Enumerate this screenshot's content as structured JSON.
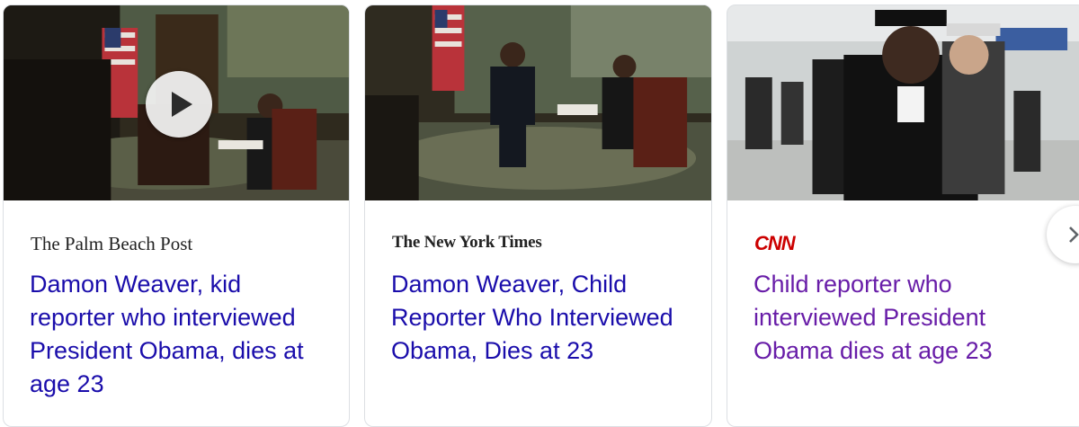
{
  "cards": [
    {
      "source": "The Palm Beach Post",
      "headline": "Damon Weaver, kid reporter who interviewed President Obama, dies at age 23",
      "has_video": true
    },
    {
      "source": "The New York Times",
      "headline": "Damon Weaver, Child Reporter Who Interviewed Obama, Dies at 23",
      "has_video": false
    },
    {
      "source": "CNN",
      "headline": "Child reporter who interviewed President Obama dies at age 23",
      "visited": true
    }
  ],
  "controls": {
    "next_icon": "chevron-right-icon",
    "play_icon": "play-icon"
  },
  "colors": {
    "link": "#1a0dab",
    "visited_link": "#681da8",
    "cnn_red": "#cc0000"
  }
}
